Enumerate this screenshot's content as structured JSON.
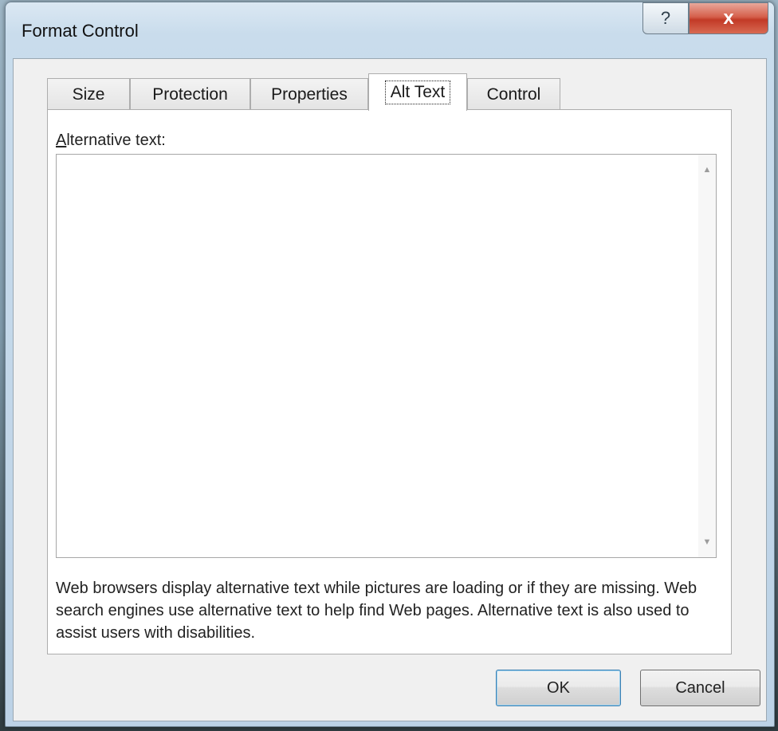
{
  "window": {
    "title": "Format Control",
    "help_glyph": "?",
    "close_glyph": "x"
  },
  "tabs": [
    {
      "label": "Size",
      "active": false
    },
    {
      "label": "Protection",
      "active": false
    },
    {
      "label": "Properties",
      "active": false
    },
    {
      "label": "Alt Text",
      "active": true
    },
    {
      "label": "Control",
      "active": false
    }
  ],
  "alt_text_tab": {
    "label_mnemonic": "A",
    "label_rest": "lternative text:",
    "textarea_value": "",
    "description": "Web browsers display alternative text while pictures are loading or if they are missing.  Web search engines use alternative text to help find Web pages. Alternative text is also used to assist users with disabilities."
  },
  "buttons": {
    "ok": "OK",
    "cancel": "Cancel"
  },
  "icons": {
    "scroll_up": "scroll-up-arrow-icon",
    "scroll_down": "scroll-down-arrow-icon"
  }
}
